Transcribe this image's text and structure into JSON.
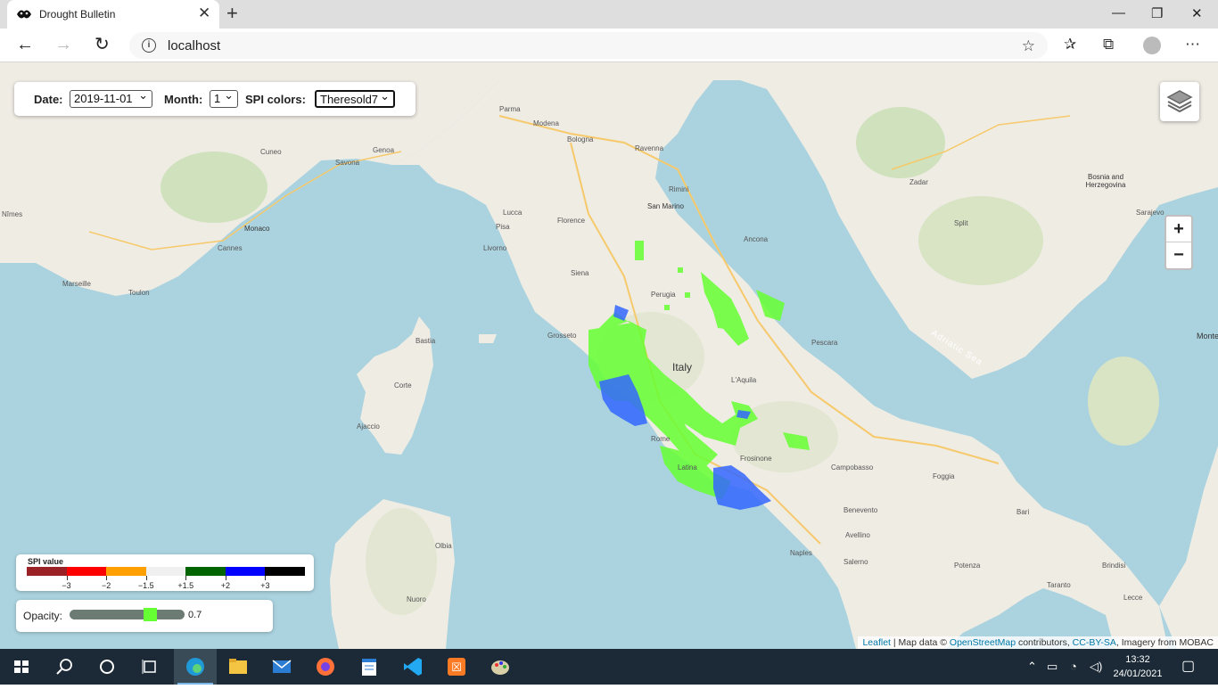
{
  "browser": {
    "tab_title": "Drought Bulletin",
    "url": "localhost"
  },
  "controls": {
    "date_label": "Date:",
    "date_value": "2019-11-01",
    "month_label": "Month:",
    "month_value": "1",
    "spi_label": "SPI colors:",
    "spi_value": "Theresold7"
  },
  "zoom": {
    "in": "+",
    "out": "−"
  },
  "legend": {
    "title": "SPI value",
    "colors": [
      "#9a2227",
      "#ff0000",
      "#ff9f00",
      "#f0f0f0",
      "#006400",
      "#0000ff",
      "#000000"
    ],
    "ticks": [
      "−3",
      "−2",
      "−1.5",
      "+1.5",
      "+2",
      "+3"
    ]
  },
  "opacity": {
    "label": "Opacity:",
    "value": "0.7",
    "fraction": 0.7
  },
  "attribution": {
    "leaflet": "Leaflet",
    "sep": " | Map data © ",
    "osm": "OpenStreetMap",
    "contrib": " contributors, ",
    "license": "CC-BY-SA",
    "imagery": ", Imagery from MOBAC"
  },
  "map_labels": {
    "italy": "Italy",
    "adriatic": "Adriatic Sea",
    "bosnia": "Bosnia and Herzegovina",
    "monaco": "Monaco",
    "san_marino": "San Marino",
    "rome": "Rome",
    "naples": "Naples",
    "florence": "Florence",
    "bologna": "Bologna",
    "genoa": "Genoa",
    "marseille": "Marseille",
    "toulon": "Toulon",
    "ajaccio": "Ajaccio",
    "bastia": "Bastia",
    "corte": "Corte",
    "sarajevo": "Sarajevo",
    "split": "Split",
    "zadar": "Zadar",
    "ancona": "Ancona",
    "pescara": "Pescara",
    "foggia": "Foggia",
    "bari": "Bari",
    "salerno": "Salerno",
    "perugia": "Perugia",
    "siena": "Siena",
    "grosseto": "Grosseto",
    "laquila": "L'Aquila",
    "campobasso": "Campobasso",
    "nuoro": "Nuoro",
    "olbia": "Olbia",
    "potenza": "Potenza",
    "brindisi": "Brindisi",
    "taranto": "Taranto",
    "lecce": "Lecce",
    "modena": "Modena",
    "parma": "Parma",
    "ravenna": "Ravenna",
    "rimini": "Rimini",
    "livorno": "Livorno",
    "pisa": "Pisa",
    "lucca": "Lucca",
    "cuneo": "Cuneo",
    "savona": "Savona",
    "cannes": "Cannes",
    "nimes": "Nîmes",
    "latina": "Latina",
    "frosinone": "Frosinone",
    "benevento": "Benevento",
    "avellino": "Avellino",
    "montenegro": "Monte"
  },
  "taskbar": {
    "time": "13:32",
    "date": "24/01/2021"
  }
}
